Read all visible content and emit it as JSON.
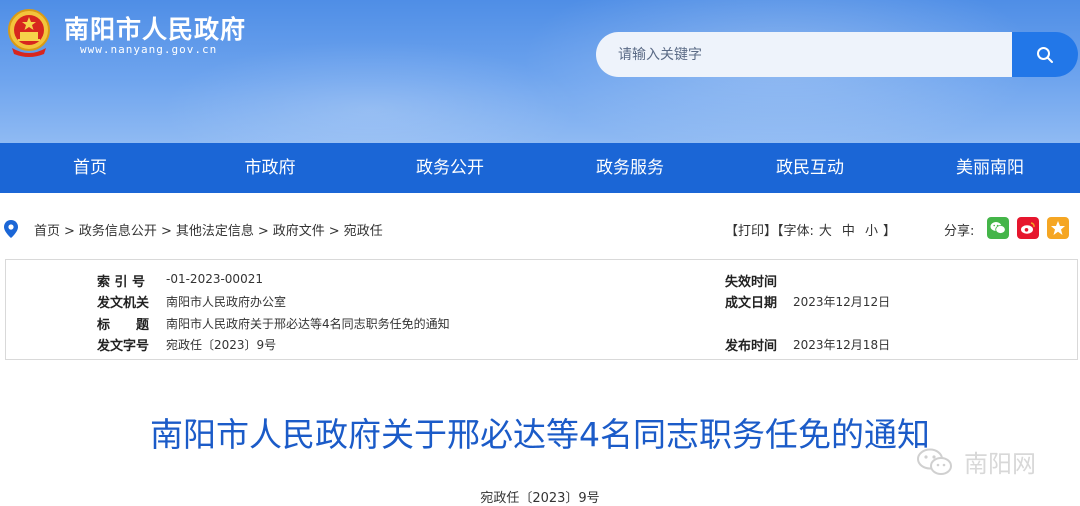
{
  "header": {
    "site_title": "南阳市人民政府",
    "site_url": "www.nanyang.gov.cn",
    "search_placeholder": "请输入关键字"
  },
  "nav": [
    "首页",
    "市政府",
    "政务公开",
    "政务服务",
    "政民互动",
    "美丽南阳"
  ],
  "breadcrumb": [
    "首页",
    "政务信息公开",
    "其他法定信息",
    "政府文件",
    "宛政任"
  ],
  "tools": {
    "print": "【打印】",
    "font_prefix": "【字体:",
    "font_large": "大",
    "font_medium": "中",
    "font_small": "小",
    "font_suffix": "】",
    "share_label": "分享:"
  },
  "info": {
    "index_label": "索 引 号",
    "index_value": "-01-2023-00021",
    "issuer_label": "发文机关",
    "issuer_value": "南阳市人民政府办公室",
    "title_label": "标　　题",
    "title_value": "南阳市人民政府关于邢必达等4名同志职务任免的通知",
    "docno_label": "发文字号",
    "docno_value": "宛政任〔2023〕9号",
    "expiry_label": "失效时间",
    "expiry_value": "",
    "date_label": "成文日期",
    "date_value": "2023年12月12日",
    "publish_label": "发布时间",
    "publish_value": "2023年12月18日"
  },
  "doc": {
    "title": "南阳市人民政府关于邢必达等4名同志职务任免的通知",
    "number": "宛政任〔2023〕9号"
  },
  "watermark": "南阳网",
  "colors": {
    "nav_bg": "#1b66d6",
    "search_btn": "#2277e8",
    "title": "#1b5bc8",
    "wechat": "#44b549",
    "weibo": "#e6162d",
    "qzone": "#f5a623"
  }
}
